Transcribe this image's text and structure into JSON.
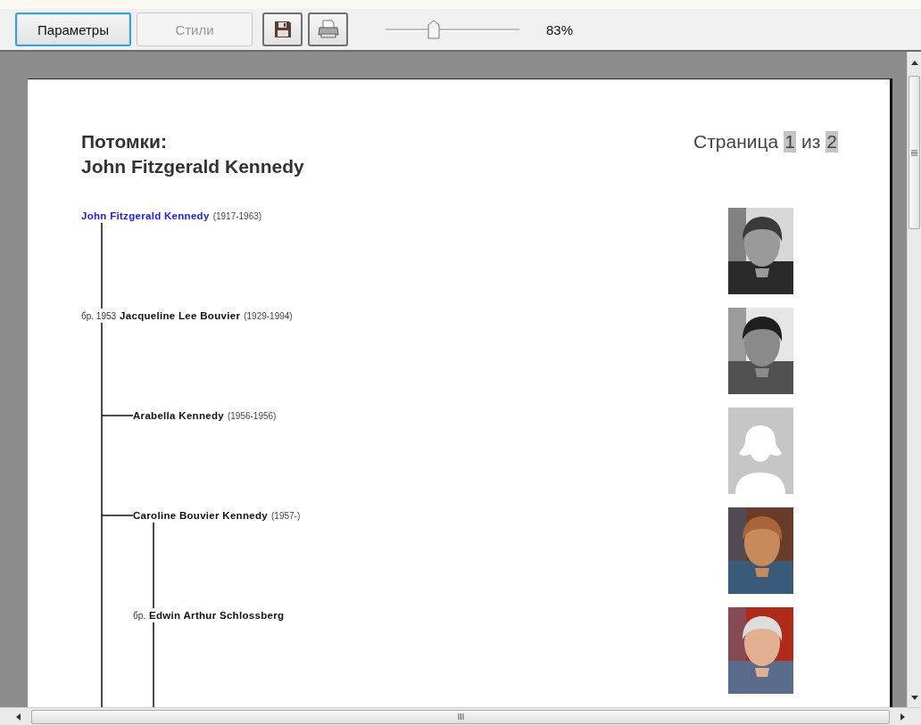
{
  "toolbar": {
    "buttons": [
      {
        "label": "Параметры",
        "focused": true,
        "disabled": false
      },
      {
        "label": "Стили",
        "focused": false,
        "disabled": true
      }
    ],
    "icon_buttons": [
      {
        "kind": "save"
      },
      {
        "kind": "print"
      }
    ],
    "zoom": {
      "level": 0.36,
      "reading": "83%"
    }
  },
  "page": {
    "title_lines": [
      "Потомки:",
      "John Fitzgerald Kennedy"
    ],
    "pager": {
      "label": "Страница",
      "current": "1",
      "separator": "из",
      "total": "2"
    },
    "tree": {
      "name": "John Fitzgerald Kennedy",
      "years": "(1917-1963)",
      "highlighted": true,
      "photo": {
        "kind": "picture"
      },
      "spouses": [
        {
          "marriage": "бр. 1953",
          "name": "Jacqueline Lee Bouvier",
          "years": "(1929-1994)",
          "highlighted": false,
          "photo": {
            "kind": "picture"
          },
          "children": [
            {
              "name": "Arabella Kennedy",
              "years": "(1956-1956)",
              "highlighted": false,
              "photo": {
                "kind": "placeholder"
              }
            },
            {
              "name": "Caroline Bouvier Kennedy",
              "years": "(1957-)",
              "highlighted": false,
              "photo": {
                "kind": "picture"
              },
              "spouses": [
                {
                  "marriage": "бр.",
                  "name": "Edwin Arthur Schlossberg",
                  "highlighted": false,
                  "photo": {
                    "kind": "picture"
                  }
                }
              ]
            }
          ]
        }
      ]
    }
  }
}
